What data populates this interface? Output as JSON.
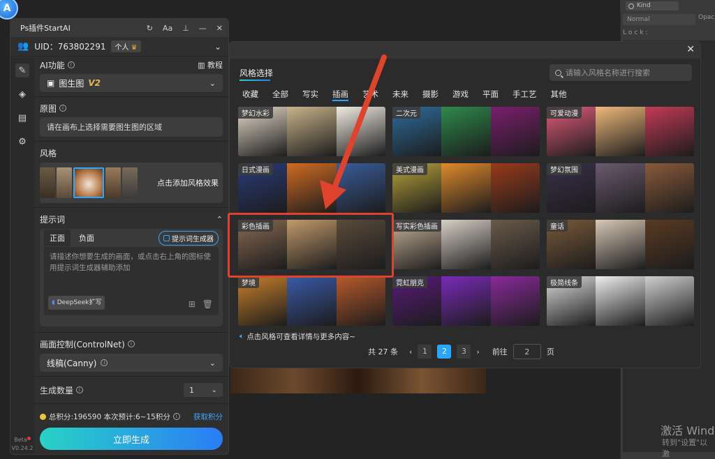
{
  "photoshop": {
    "kind_filter": "Kind",
    "blend_mode": "Normal",
    "opacity_label": "Opac",
    "lock_label": "Lock:",
    "watermark_title": "激活 Wind",
    "watermark_sub": "转到\"设置\"以激"
  },
  "plugin": {
    "logo_letter": "A",
    "title": "Ps插件StartAI",
    "title_buttons": [
      "↻",
      "Aa",
      "⊥",
      "—",
      "✕"
    ],
    "uid_label": "UID：763802291",
    "account_badge": "个人",
    "ai_function_label": "AI功能",
    "tutorial_label": "教程",
    "ai_function_value": "图生图",
    "ai_function_version": "V2",
    "source_label": "原图",
    "source_placeholder": "请在画布上选择需要图生图的区域",
    "style_label": "风格",
    "add_style_label": "点击添加风格效果",
    "prompt_label": "提示词",
    "prompt_tabs": [
      "正面",
      "负面"
    ],
    "prompt_generator_label": "提示词生成器",
    "prompt_placeholder": "请描述你想要生成的画面，或点击右上角的图标使用提示词生成器辅助添加",
    "deepseek_label": "DeepSeek扩写",
    "controlnet_label": "画面控制(ControlNet)",
    "controlnet_value": "线稿(Canny)",
    "quantity_label": "生成数量",
    "quantity_value": "1",
    "points_text": "总积分:196590  本次预计:6~15积分",
    "get_points_label": "获取积分",
    "generate_label": "立即生成",
    "beta_label": "Beta",
    "version_label": "V0.24.2"
  },
  "popup": {
    "title": "风格选择",
    "search_placeholder": "请输入风格名称进行搜索",
    "categories": [
      "收藏",
      "全部",
      "写实",
      "插画",
      "艺术",
      "未来",
      "摄影",
      "游戏",
      "平面",
      "手工艺",
      "其他"
    ],
    "active_category": "插画",
    "styles": [
      {
        "name": "梦幻水彩",
        "colors": [
          "#e7dccb",
          "#c9b48a",
          "#f1ece2"
        ]
      },
      {
        "name": "二次元",
        "colors": [
          "#2d6e9c",
          "#2e8a4a",
          "#7b1e6d"
        ]
      },
      {
        "name": "可爱动漫",
        "colors": [
          "#e35c7a",
          "#f0b97a",
          "#c43a55"
        ]
      },
      {
        "name": "日式漫画",
        "colors": [
          "#2a3b7a",
          "#d16b22",
          "#3a5c9a"
        ]
      },
      {
        "name": "美式漫画",
        "colors": [
          "#b8a33a",
          "#e08a2c",
          "#9a3a1c"
        ]
      },
      {
        "name": "梦幻氛围",
        "colors": [
          "#3a2f4a",
          "#6b5a6e",
          "#8a5a3a"
        ]
      },
      {
        "name": "彩色插画",
        "colors": [
          "#8a6a52",
          "#c29a6a",
          "#5a4a3a"
        ]
      },
      {
        "name": "写实彩色插画",
        "colors": [
          "#c9b49a",
          "#d8d0c6",
          "#6a5a4a"
        ]
      },
      {
        "name": "童话",
        "colors": [
          "#7a5a3a",
          "#d8c8b6",
          "#5a3a22"
        ]
      },
      {
        "name": "梦境",
        "colors": [
          "#c9812a",
          "#3a5aa8",
          "#b85a2a"
        ]
      },
      {
        "name": "霓虹朋克",
        "colors": [
          "#5a1a7a",
          "#7a2ab8",
          "#8a2a9a"
        ]
      },
      {
        "name": "极简线条",
        "colors": [
          "#dcdcdc",
          "#eeeeee",
          "#cfcfcf"
        ]
      }
    ],
    "hint": "点击风格可查看详情与更多内容~",
    "total": "共 27 条",
    "pages": [
      "1",
      "2",
      "3"
    ],
    "current_page": "2",
    "goto_label": "前往",
    "goto_value": "2",
    "page_suffix": "页"
  },
  "colors": {
    "accent_blue": "#2ba6ff",
    "highlight_red": "#e0432c",
    "generate_gradient_start": "#27d3c5",
    "generate_gradient_end": "#2b7cf6"
  }
}
